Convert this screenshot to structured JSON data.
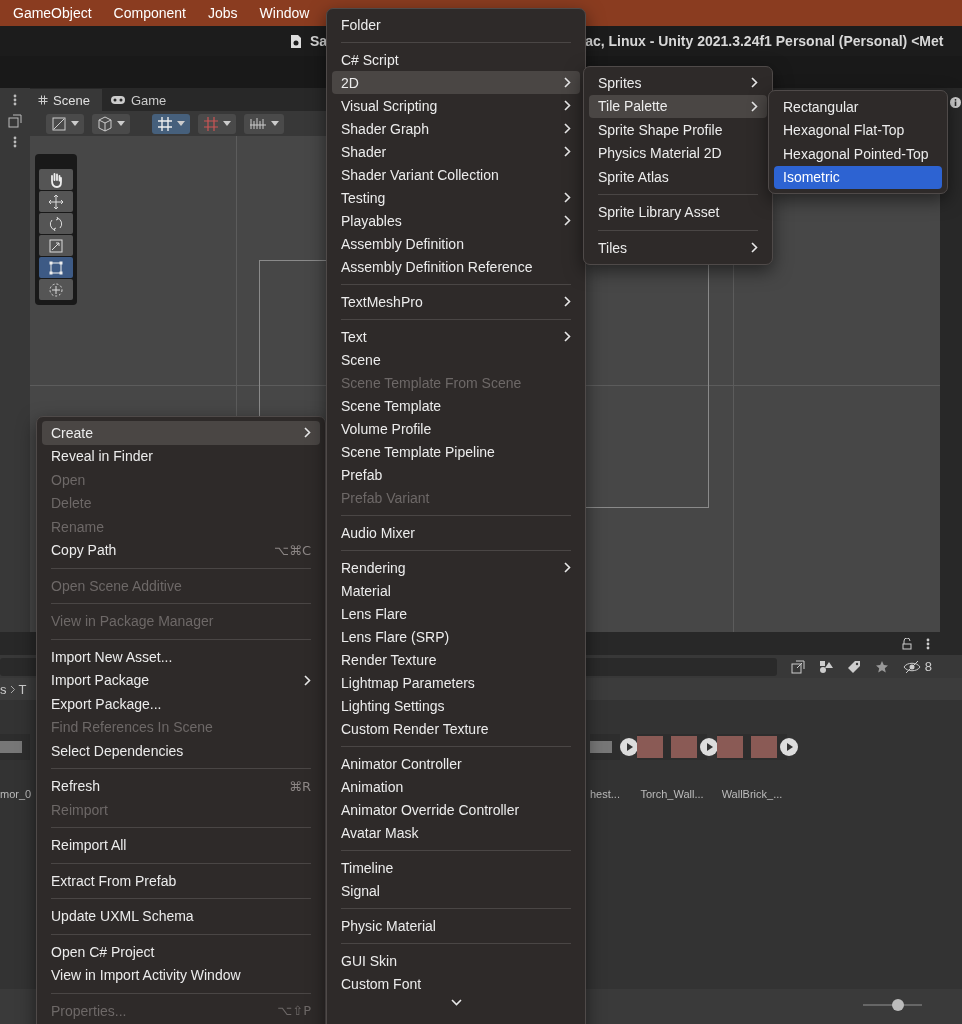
{
  "menu_bar": {
    "items": [
      "GameObject",
      "Component",
      "Jobs",
      "Window"
    ]
  },
  "title_bar": {
    "parts": [
      "Sa",
      "ac, Linux - Unity 2021.3.24f1 Personal (Personal) <Met"
    ]
  },
  "scene_tabs": [
    {
      "label": "Scene",
      "selected": true
    },
    {
      "label": "Game",
      "selected": false
    }
  ],
  "scene_toolbar": [
    {
      "kind": "draw-mode",
      "on": false
    },
    {
      "kind": "cube",
      "on": false
    },
    {
      "kind": "grid-snap",
      "on": true
    },
    {
      "kind": "grid",
      "on": false
    },
    {
      "kind": "gizmos",
      "on": false
    }
  ],
  "scene_tools": [
    {
      "kind": "hand",
      "selected": false
    },
    {
      "kind": "move",
      "selected": false
    },
    {
      "kind": "rotate",
      "selected": false
    },
    {
      "kind": "scale",
      "selected": false
    },
    {
      "kind": "rect",
      "selected": true
    },
    {
      "kind": "transform",
      "selected": false
    }
  ],
  "project": {
    "breadcrumb": [
      "s",
      "T"
    ],
    "hidden_count": "8",
    "assets": [
      {
        "label": "mor_0",
        "kind": "partial"
      },
      {
        "label": "hest...",
        "kind": "partial"
      },
      {
        "label": "Torch_Wall...",
        "kind": "full"
      },
      {
        "label": "WallBrick_...",
        "kind": "full"
      }
    ],
    "zoom": {
      "level": 0.6
    }
  },
  "menus": [
    {
      "more_below": false,
      "items": [
        {
          "kind": "item",
          "label": "Create",
          "submenu": true,
          "disabled": false,
          "selected": true
        },
        {
          "kind": "item",
          "label": "Reveal in Finder",
          "submenu": false,
          "disabled": false,
          "selected": false
        },
        {
          "kind": "item",
          "label": "Open",
          "submenu": false,
          "disabled": true,
          "selected": false
        },
        {
          "kind": "item",
          "label": "Delete",
          "submenu": false,
          "disabled": true,
          "selected": false
        },
        {
          "kind": "item",
          "label": "Rename",
          "submenu": false,
          "disabled": true,
          "selected": false
        },
        {
          "kind": "item",
          "label": "Copy Path",
          "shortcut": "⌥⌘C",
          "submenu": false,
          "disabled": false,
          "selected": false
        },
        {
          "kind": "separator"
        },
        {
          "kind": "item",
          "label": "Open Scene Additive",
          "submenu": false,
          "disabled": true,
          "selected": false
        },
        {
          "kind": "separator"
        },
        {
          "kind": "item",
          "label": "View in Package Manager",
          "submenu": false,
          "disabled": true,
          "selected": false
        },
        {
          "kind": "separator"
        },
        {
          "kind": "item",
          "label": "Import New Asset...",
          "submenu": false,
          "disabled": false,
          "selected": false
        },
        {
          "kind": "item",
          "label": "Import Package",
          "submenu": true,
          "disabled": false,
          "selected": false
        },
        {
          "kind": "item",
          "label": "Export Package...",
          "submenu": false,
          "disabled": false,
          "selected": false
        },
        {
          "kind": "item",
          "label": "Find References In Scene",
          "submenu": false,
          "disabled": true,
          "selected": false
        },
        {
          "kind": "item",
          "label": "Select Dependencies",
          "submenu": false,
          "disabled": false,
          "selected": false
        },
        {
          "kind": "separator"
        },
        {
          "kind": "item",
          "label": "Refresh",
          "shortcut": "⌘R",
          "submenu": false,
          "disabled": false,
          "selected": false
        },
        {
          "kind": "item",
          "label": "Reimport",
          "submenu": false,
          "disabled": true,
          "selected": false
        },
        {
          "kind": "separator"
        },
        {
          "kind": "item",
          "label": "Reimport All",
          "submenu": false,
          "disabled": false,
          "selected": false
        },
        {
          "kind": "separator"
        },
        {
          "kind": "item",
          "label": "Extract From Prefab",
          "submenu": false,
          "disabled": false,
          "selected": false
        },
        {
          "kind": "separator"
        },
        {
          "kind": "item",
          "label": "Update UXML Schema",
          "submenu": false,
          "disabled": false,
          "selected": false
        },
        {
          "kind": "separator"
        },
        {
          "kind": "item",
          "label": "Open C# Project",
          "submenu": false,
          "disabled": false,
          "selected": false
        },
        {
          "kind": "item",
          "label": "View in Import Activity Window",
          "submenu": false,
          "disabled": false,
          "selected": false
        },
        {
          "kind": "separator"
        },
        {
          "kind": "item",
          "label": "Properties...",
          "shortcut": "⌥⇧P",
          "submenu": false,
          "disabled": true,
          "selected": false
        }
      ]
    },
    {
      "more_below": true,
      "items": [
        {
          "kind": "item",
          "label": "Folder",
          "submenu": false,
          "disabled": false,
          "selected": false
        },
        {
          "kind": "separator"
        },
        {
          "kind": "item",
          "label": "C# Script",
          "submenu": false,
          "disabled": false,
          "selected": false
        },
        {
          "kind": "item",
          "label": "2D",
          "submenu": true,
          "disabled": false,
          "selected": true
        },
        {
          "kind": "item",
          "label": "Visual Scripting",
          "submenu": true,
          "disabled": false,
          "selected": false
        },
        {
          "kind": "item",
          "label": "Shader Graph",
          "submenu": true,
          "disabled": false,
          "selected": false
        },
        {
          "kind": "item",
          "label": "Shader",
          "submenu": true,
          "disabled": false,
          "selected": false
        },
        {
          "kind": "item",
          "label": "Shader Variant Collection",
          "submenu": false,
          "disabled": false,
          "selected": false
        },
        {
          "kind": "item",
          "label": "Testing",
          "submenu": true,
          "disabled": false,
          "selected": false
        },
        {
          "kind": "item",
          "label": "Playables",
          "submenu": true,
          "disabled": false,
          "selected": false
        },
        {
          "kind": "item",
          "label": "Assembly Definition",
          "submenu": false,
          "disabled": false,
          "selected": false
        },
        {
          "kind": "item",
          "label": "Assembly Definition Reference",
          "submenu": false,
          "disabled": false,
          "selected": false
        },
        {
          "kind": "separator"
        },
        {
          "kind": "item",
          "label": "TextMeshPro",
          "submenu": true,
          "disabled": false,
          "selected": false
        },
        {
          "kind": "separator"
        },
        {
          "kind": "item",
          "label": "Text",
          "submenu": true,
          "disabled": false,
          "selected": false
        },
        {
          "kind": "item",
          "label": "Scene",
          "submenu": false,
          "disabled": false,
          "selected": false
        },
        {
          "kind": "item",
          "label": "Scene Template From Scene",
          "submenu": false,
          "disabled": true,
          "selected": false
        },
        {
          "kind": "item",
          "label": "Scene Template",
          "submenu": false,
          "disabled": false,
          "selected": false
        },
        {
          "kind": "item",
          "label": "Volume Profile",
          "submenu": false,
          "disabled": false,
          "selected": false
        },
        {
          "kind": "item",
          "label": "Scene Template Pipeline",
          "submenu": false,
          "disabled": false,
          "selected": false
        },
        {
          "kind": "item",
          "label": "Prefab",
          "submenu": false,
          "disabled": false,
          "selected": false
        },
        {
          "kind": "item",
          "label": "Prefab Variant",
          "submenu": false,
          "disabled": true,
          "selected": false
        },
        {
          "kind": "separator"
        },
        {
          "kind": "item",
          "label": "Audio Mixer",
          "submenu": false,
          "disabled": false,
          "selected": false
        },
        {
          "kind": "separator"
        },
        {
          "kind": "item",
          "label": "Rendering",
          "submenu": true,
          "disabled": false,
          "selected": false
        },
        {
          "kind": "item",
          "label": "Material",
          "submenu": false,
          "disabled": false,
          "selected": false
        },
        {
          "kind": "item",
          "label": "Lens Flare",
          "submenu": false,
          "disabled": false,
          "selected": false
        },
        {
          "kind": "item",
          "label": "Lens Flare (SRP)",
          "submenu": false,
          "disabled": false,
          "selected": false
        },
        {
          "kind": "item",
          "label": "Render Texture",
          "submenu": false,
          "disabled": false,
          "selected": false
        },
        {
          "kind": "item",
          "label": "Lightmap Parameters",
          "submenu": false,
          "disabled": false,
          "selected": false
        },
        {
          "kind": "item",
          "label": "Lighting Settings",
          "submenu": false,
          "disabled": false,
          "selected": false
        },
        {
          "kind": "item",
          "label": "Custom Render Texture",
          "submenu": false,
          "disabled": false,
          "selected": false
        },
        {
          "kind": "separator"
        },
        {
          "kind": "item",
          "label": "Animator Controller",
          "submenu": false,
          "disabled": false,
          "selected": false
        },
        {
          "kind": "item",
          "label": "Animation",
          "submenu": false,
          "disabled": false,
          "selected": false
        },
        {
          "kind": "item",
          "label": "Animator Override Controller",
          "submenu": false,
          "disabled": false,
          "selected": false
        },
        {
          "kind": "item",
          "label": "Avatar Mask",
          "submenu": false,
          "disabled": false,
          "selected": false
        },
        {
          "kind": "separator"
        },
        {
          "kind": "item",
          "label": "Timeline",
          "submenu": false,
          "disabled": false,
          "selected": false
        },
        {
          "kind": "item",
          "label": "Signal",
          "submenu": false,
          "disabled": false,
          "selected": false
        },
        {
          "kind": "separator"
        },
        {
          "kind": "item",
          "label": "Physic Material",
          "submenu": false,
          "disabled": false,
          "selected": false
        },
        {
          "kind": "separator"
        },
        {
          "kind": "item",
          "label": "GUI Skin",
          "submenu": false,
          "disabled": false,
          "selected": false
        },
        {
          "kind": "item",
          "label": "Custom Font",
          "submenu": false,
          "disabled": false,
          "selected": false
        }
      ]
    },
    {
      "more_below": false,
      "items": [
        {
          "kind": "item",
          "label": "Sprites",
          "submenu": true,
          "disabled": false,
          "selected": false
        },
        {
          "kind": "item",
          "label": "Tile Palette",
          "submenu": true,
          "disabled": false,
          "selected": true
        },
        {
          "kind": "item",
          "label": "Sprite Shape Profile",
          "submenu": false,
          "disabled": false,
          "selected": false
        },
        {
          "kind": "item",
          "label": "Physics Material 2D",
          "submenu": false,
          "disabled": false,
          "selected": false
        },
        {
          "kind": "item",
          "label": "Sprite Atlas",
          "submenu": false,
          "disabled": false,
          "selected": false
        },
        {
          "kind": "separator"
        },
        {
          "kind": "item",
          "label": "Sprite Library Asset",
          "submenu": false,
          "disabled": false,
          "selected": false
        },
        {
          "kind": "separator"
        },
        {
          "kind": "item",
          "label": "Tiles",
          "submenu": true,
          "disabled": false,
          "selected": false
        }
      ]
    },
    {
      "more_below": false,
      "items": [
        {
          "kind": "item",
          "label": "Rectangular",
          "disabled": false,
          "selected": false
        },
        {
          "kind": "item",
          "label": "Hexagonal Flat-Top",
          "disabled": false,
          "selected": false
        },
        {
          "kind": "item",
          "label": "Hexagonal Pointed-Top",
          "disabled": false,
          "selected": false
        },
        {
          "kind": "item",
          "label": "Isometric",
          "disabled": false,
          "selected": true
        }
      ]
    }
  ]
}
